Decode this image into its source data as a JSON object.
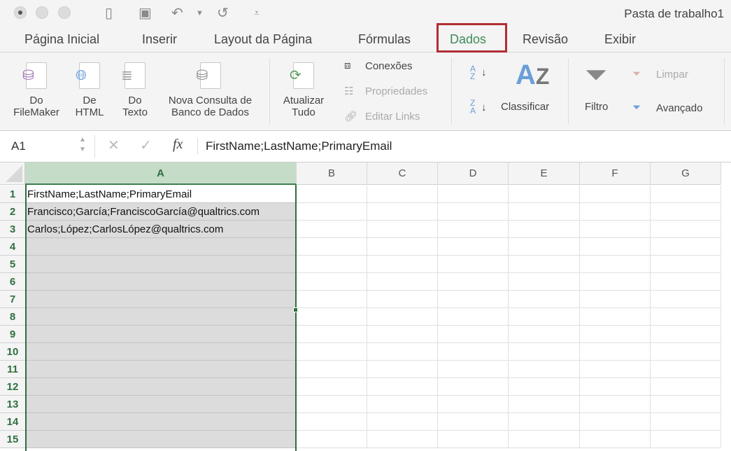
{
  "window": {
    "title": "Pasta de trabalho1"
  },
  "tabs": [
    "Página Inicial",
    "Inserir",
    "Layout da Página",
    "Fórmulas",
    "Dados",
    "Revisão",
    "Exibir"
  ],
  "active_tab": "Dados",
  "ribbon": {
    "from_filemaker": [
      "Do",
      "FileMaker"
    ],
    "from_html": [
      "De",
      "HTML"
    ],
    "from_text": [
      "Do",
      "Texto"
    ],
    "new_query": [
      "Nova Consulta de",
      "Banco de Dados"
    ],
    "refresh_all": [
      "Atualizar",
      "Tudo"
    ],
    "connections": "Conexões",
    "properties": "Propriedades",
    "edit_links": "Editar Links",
    "sort": "Classificar",
    "sort_az": "A Z",
    "sort_za": "Z A",
    "filter": "Filtro",
    "clear": "Limpar",
    "advanced": "Avançado"
  },
  "formula_bar": {
    "name_box": "A1",
    "fx": "fx",
    "value": "FirstName;LastName;PrimaryEmail"
  },
  "columns": [
    "A",
    "B",
    "C",
    "D",
    "E",
    "F",
    "G"
  ],
  "rows": [
    "1",
    "2",
    "3",
    "4",
    "5",
    "6",
    "7",
    "8",
    "9",
    "10",
    "11",
    "12",
    "13",
    "14",
    "15"
  ],
  "cells": {
    "A1": "FirstName;LastName;PrimaryEmail",
    "A2": "Francisco;García;FranciscoGarcía@qualtrics.com",
    "A3": "Carlos;López;CarlosLópez@qualtrics.com"
  },
  "colors": {
    "accent": "#3f8a5b",
    "highlight_box": "#b22d33",
    "selection": "#2e6f40"
  }
}
